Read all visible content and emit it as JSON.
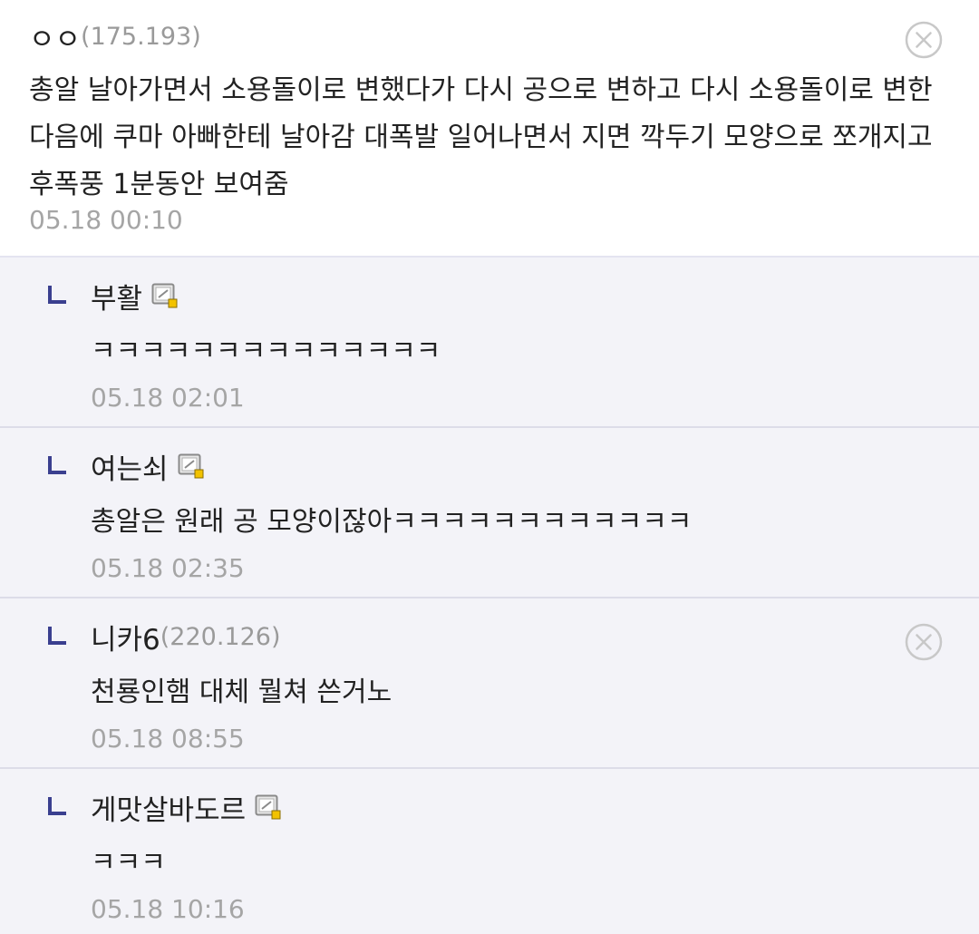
{
  "main_comment": {
    "nickname": "ㅇㅇ",
    "ip": "(175.193)",
    "text": "총알 날아가면서 소용돌이로 변했다가 다시 공으로 변하고 다시 소용돌이로 변한 다음에 쿠마 아빠한테 날아감 대폭발 일어나면서 지면 깍두기 모양으로 쪼개지고 후폭풍 1분동안 보여줌",
    "date": "05.18 00:10",
    "delete_icon": "circle-x-icon"
  },
  "replies": [
    {
      "nickname": "부활",
      "ip": "",
      "text": "ㅋㅋㅋㅋㅋㅋㅋㅋㅋㅋㅋㅋㅋㅋ",
      "date": "05.18 02:01",
      "user_icon": "fixed-nick-icon"
    },
    {
      "nickname": "여는쇠",
      "ip": "",
      "text": "총알은 원래 공 모양이잖아ㅋㅋㅋㅋㅋㅋㅋㅋㅋㅋㅋㅋ",
      "date": "05.18 02:35",
      "user_icon": "fixed-nick-icon"
    },
    {
      "nickname": "니카6",
      "ip": "(220.126)",
      "text": "천룡인햄 대체 뭘쳐 쓴거노",
      "date": "05.18 08:55",
      "delete_icon": "circle-x-icon"
    },
    {
      "nickname": "게맛살바도르",
      "ip": "",
      "text": "ㅋㅋㅋ",
      "date": "05.18 10:16",
      "user_icon": "fixed-nick-icon"
    }
  ],
  "colors": {
    "reply_bg": "#f3f3f8",
    "divider": "#dcdce8",
    "reply_arrow": "#3a3f8f",
    "meta_gray": "#a5a5a5"
  }
}
